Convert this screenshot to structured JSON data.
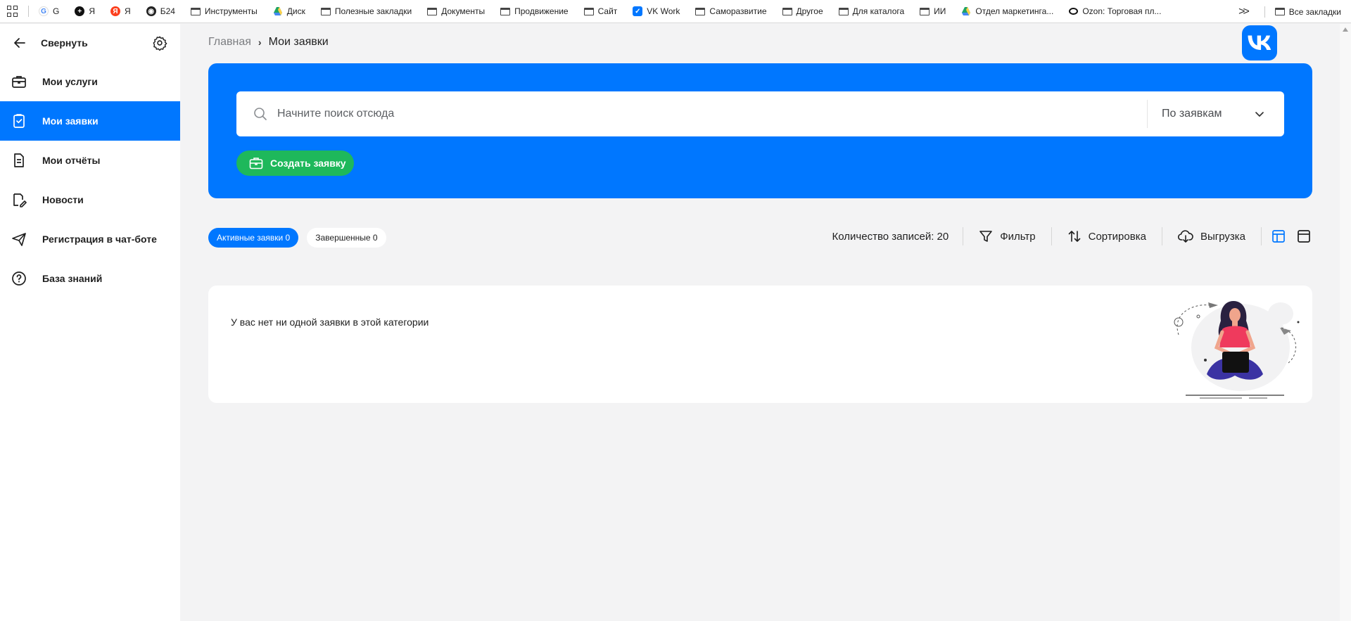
{
  "bookmarks": {
    "items": [
      {
        "label": "G",
        "icon": "google-icon"
      },
      {
        "label": "Я",
        "icon": "plus-circle-icon"
      },
      {
        "label": "Я",
        "icon": "yandex-icon"
      },
      {
        "label": "Б24",
        "icon": "globe-icon"
      },
      {
        "label": "Инструменты",
        "icon": "folder-icon"
      },
      {
        "label": "Диск",
        "icon": "drive-icon"
      },
      {
        "label": "Полезные закладки",
        "icon": "folder-icon"
      },
      {
        "label": "Документы",
        "icon": "folder-icon"
      },
      {
        "label": "Продвижение",
        "icon": "folder-icon"
      },
      {
        "label": "Сайт",
        "icon": "folder-icon"
      },
      {
        "label": "VK Work",
        "icon": "vk-work-icon"
      },
      {
        "label": "Саморазвитие",
        "icon": "folder-icon"
      },
      {
        "label": "Другое",
        "icon": "folder-icon"
      },
      {
        "label": "Для каталога",
        "icon": "folder-icon"
      },
      {
        "label": "ИИ",
        "icon": "folder-icon"
      },
      {
        "label": "Отдел маркетинга...",
        "icon": "drive-icon"
      },
      {
        "label": "Ozon: Торговая пл...",
        "icon": "ozon-icon"
      }
    ],
    "all_label": "Все закладки"
  },
  "sidebar": {
    "collapse_label": "Свернуть",
    "items": [
      {
        "label": "Мои услуги",
        "icon": "briefcase-icon",
        "active": false
      },
      {
        "label": "Мои заявки",
        "icon": "clipboard-check-icon",
        "active": true
      },
      {
        "label": "Мои отчёты",
        "icon": "document-icon",
        "active": false
      },
      {
        "label": "Новости",
        "icon": "news-pen-icon",
        "active": false
      },
      {
        "label": "Регистрация в чат-боте",
        "icon": "paper-plane-icon",
        "active": false
      },
      {
        "label": "База знаний",
        "icon": "question-circle-icon",
        "active": false
      }
    ]
  },
  "breadcrumb": {
    "home": "Главная",
    "separator": "›",
    "current": "Мои заявки"
  },
  "search": {
    "placeholder": "Начните поиск отсюда",
    "scope": "По заявкам"
  },
  "create_button": "Создать заявку",
  "tabs": [
    {
      "label": "Активные заявки 0",
      "active": true
    },
    {
      "label": "Завершенные 0",
      "active": false
    }
  ],
  "toolbar": {
    "count": "Количество записей: 20",
    "filter": "Фильтр",
    "sort": "Сортировка",
    "export": "Выгрузка"
  },
  "empty_state": {
    "message": "У вас нет ни одной заявки в этой категории"
  },
  "colors": {
    "accent": "#0077ff",
    "create_button": "#1eb85b",
    "background": "#f3f3f4"
  }
}
